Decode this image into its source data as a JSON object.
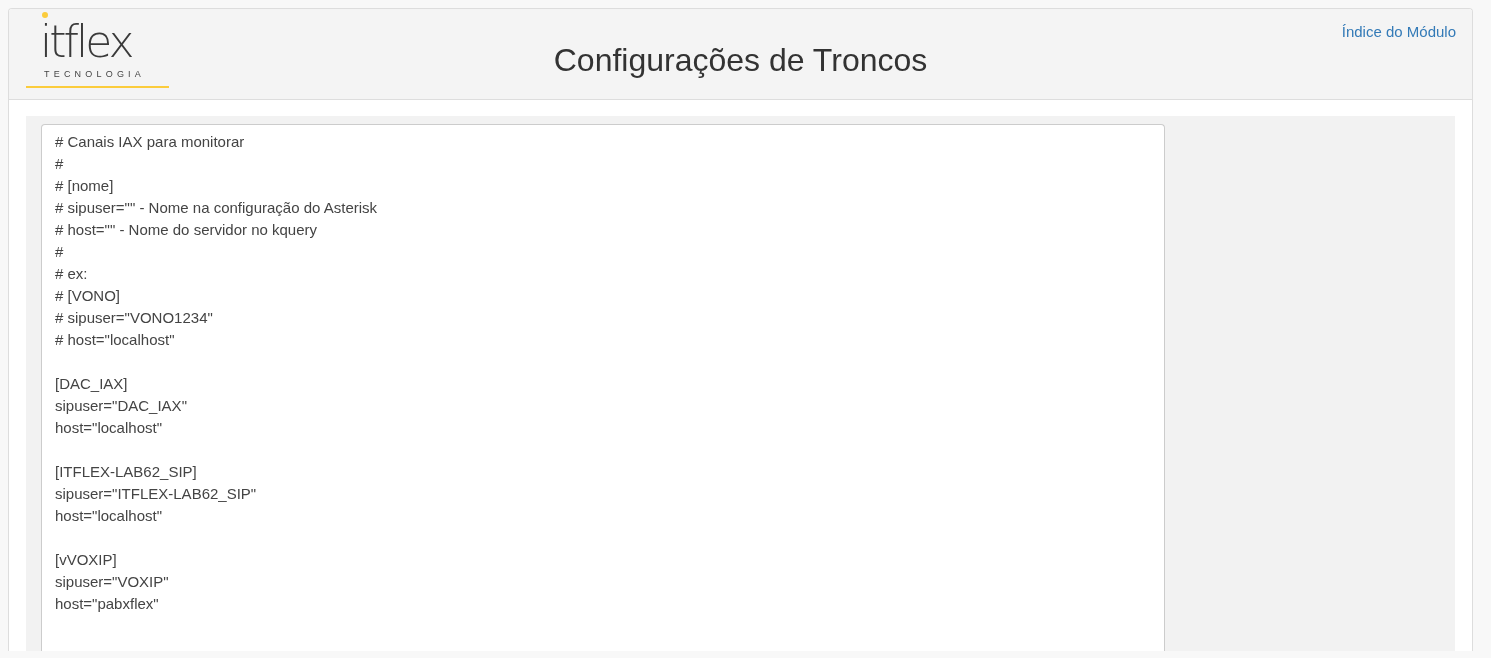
{
  "header": {
    "logo": {
      "wordmark": "itflex",
      "tagline": "TECNOLOGIA"
    },
    "title": "Configurações de Troncos",
    "link": "Índice do Módulo"
  },
  "editor": {
    "blocks": [
      {
        "lines": [
          "# Canais IAX para monitorar",
          "#",
          "# [nome]",
          "# sipuser=\"\" - Nome na configuração do Asterisk",
          "# host=\"\" - Nome do servidor no kquery",
          "#",
          "# ex:",
          "# [VONO]",
          "# sipuser=\"VONO1234\"",
          "# host=\"localhost\""
        ]
      },
      {
        "lines": [
          "[DAC_IAX]",
          "sipuser=\"DAC_IAX\"",
          "host=\"localhost\""
        ]
      },
      {
        "lines": [
          "[ITFLEX-LAB62_SIP]",
          "sipuser=\"ITFLEX-LAB62_SIP\"",
          "host=\"localhost\""
        ]
      },
      {
        "lines": [
          "[vVOXIP]",
          "sipuser=\"VOXIP\"",
          "host=\"pabxflex\""
        ]
      }
    ]
  }
}
